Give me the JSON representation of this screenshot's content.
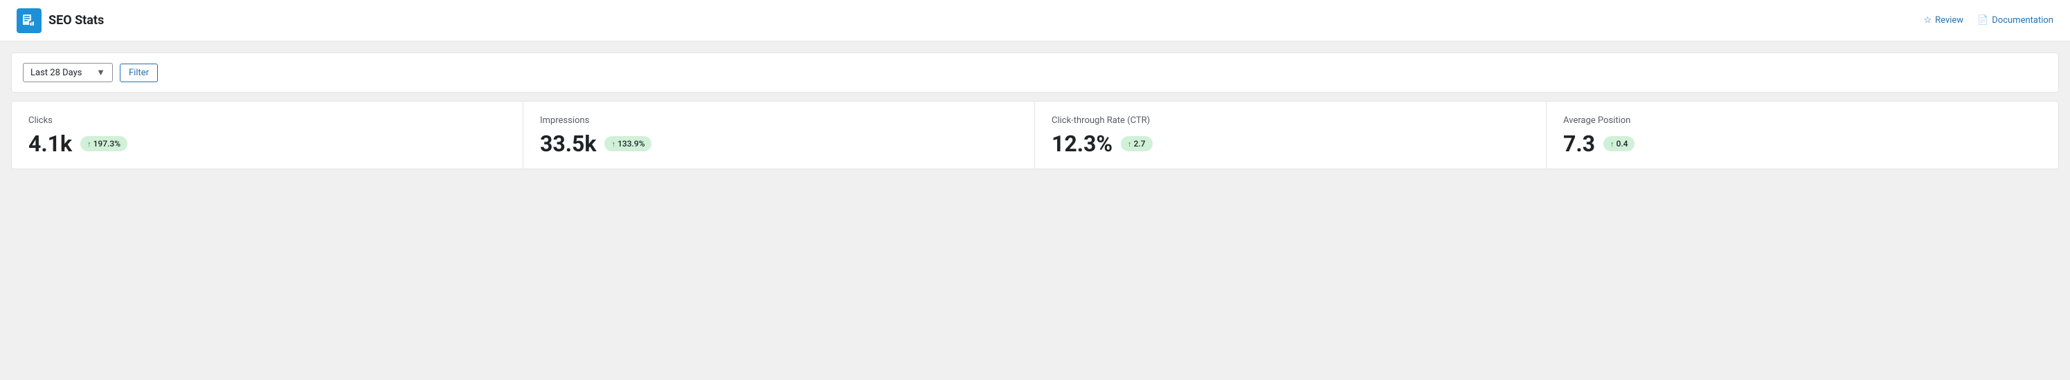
{
  "header": {
    "title": "SEO Stats",
    "review_label": "Review",
    "documentation_label": "Documentation"
  },
  "filter_bar": {
    "date_range_value": "Last 28 Days",
    "date_range_placeholder": "Last 28 Days",
    "filter_button_label": "Filter"
  },
  "stats": [
    {
      "id": "clicks",
      "label": "Clicks",
      "value": "4.1k",
      "badge": "197.3%",
      "badge_direction": "up"
    },
    {
      "id": "impressions",
      "label": "Impressions",
      "value": "33.5k",
      "badge": "133.9%",
      "badge_direction": "up"
    },
    {
      "id": "ctr",
      "label": "Click-through Rate (CTR)",
      "value": "12.3%",
      "badge": "2.7",
      "badge_direction": "up"
    },
    {
      "id": "avg-position",
      "label": "Average Position",
      "value": "7.3",
      "badge": "0.4",
      "badge_direction": "up"
    }
  ],
  "icons": {
    "chevron_down": "▼",
    "arrow_up": "↑",
    "star": "☆",
    "document": "📄"
  }
}
